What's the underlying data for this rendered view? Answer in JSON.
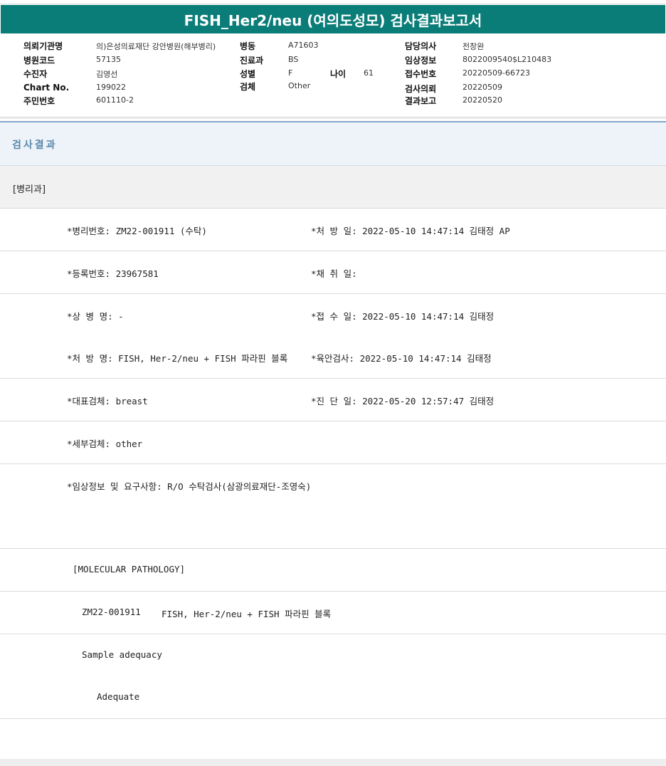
{
  "report": {
    "title": "FISH_Her2/neu (여의도성모) 검사결과보고서"
  },
  "info": {
    "inst_label": "의뢰기관명",
    "inst_value": "의)은성의료재단 강안병원(해부병리)",
    "hospcode_label": "병원코드",
    "hospcode_value": "57135",
    "patient_label": "수진자",
    "patient_value": "김영선",
    "chart_label": "Chart No.",
    "chart_value": "199022",
    "resident_label": "주민번호",
    "resident_value": "601110-2",
    "ward_label": "병동",
    "ward_value": "A71603",
    "dept_label": "진료과",
    "dept_value": "BS",
    "sex_label": "성별",
    "sex_value": "F",
    "age_label": "나이",
    "age_value": "61",
    "specimen_label": "검체",
    "specimen_value": "Other",
    "doctor_label": "담당의사",
    "doctor_value": "전창완",
    "clinical_label": "임상정보",
    "clinical_value": "8022009540$L210483",
    "receipt_label": "접수번호",
    "receipt_value": "20220509-66723",
    "request_label": "검사의뢰",
    "request_value": "20220509",
    "reportdate_label": "결과보고",
    "reportdate_value": "20220520"
  },
  "results": {
    "header": "검사결과",
    "department": "[병리과]",
    "path_no": "*병리번호: ZM22-001911 (수탁)",
    "order_date": "*처 방 일: 2022-05-10 14:47:14  김태정 AP",
    "reg_no": "*등록번호: 23967581",
    "collect_date": "*채 취 일:",
    "diagnosis": "*상 병 명: -",
    "receipt_date": "*접 수 일: 2022-05-10 14:47:14  김태정",
    "order_name": "*처 방 명: FISH, Her-2/neu + FISH 파라핀 블록",
    "gross_date": "*육안검사: 2022-05-10 14:47:14  김태정",
    "rep_specimen": "*대표검체: breast",
    "dx_date": "*진 단 일: 2022-05-20 12:57:47  김태정",
    "sub_specimen": "*세부검체: other",
    "clinical_req": "*임상정보 및 요구사항: R/O 수탁검사(삼광의료재단-조영숙)",
    "mp_header": "[MOLECULAR PATHOLOGY]",
    "mp_case_no": "ZM22-001911",
    "mp_test": "FISH, Her-2/neu + FISH 파라핀 블록",
    "adequacy_label": "Sample adequacy",
    "adequacy_value": "Adequate"
  }
}
